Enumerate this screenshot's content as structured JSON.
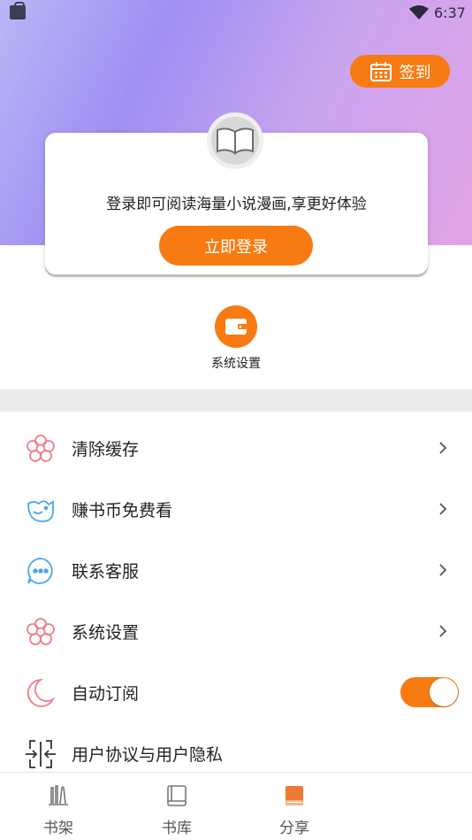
{
  "status_bar": {
    "time": "6:37"
  },
  "header": {
    "checkin_label": "签到"
  },
  "login_card": {
    "prompt": "登录即可阅读海量小说漫画,享更好体验",
    "login_button": "立即登录"
  },
  "quick_actions": [
    {
      "label": "系统设置",
      "icon": "wallet-icon"
    }
  ],
  "menu": [
    {
      "label": "清除缓存",
      "icon": "flower-icon",
      "action": "chevron"
    },
    {
      "label": "赚书币免费看",
      "icon": "bird-icon",
      "action": "chevron"
    },
    {
      "label": "联系客服",
      "icon": "chat-bubble-icon",
      "action": "chevron"
    },
    {
      "label": "系统设置",
      "icon": "flower-icon",
      "action": "chevron"
    },
    {
      "label": "自动订阅",
      "icon": "moon-icon",
      "action": "toggle",
      "toggle_on": true
    },
    {
      "label": "用户协议与用户隐私",
      "icon": "expand-icon",
      "action": "none"
    }
  ],
  "tabs": [
    {
      "label": "书架",
      "icon": "bookshelf-icon",
      "active": false
    },
    {
      "label": "书库",
      "icon": "book-library-icon",
      "active": false
    },
    {
      "label": "分享",
      "icon": "share-book-icon",
      "active": true
    }
  ],
  "colors": {
    "accent": "#f77a12",
    "icon_pink": "#f07c8c",
    "icon_blue": "#4aa7e8",
    "divider": "#ececec"
  }
}
